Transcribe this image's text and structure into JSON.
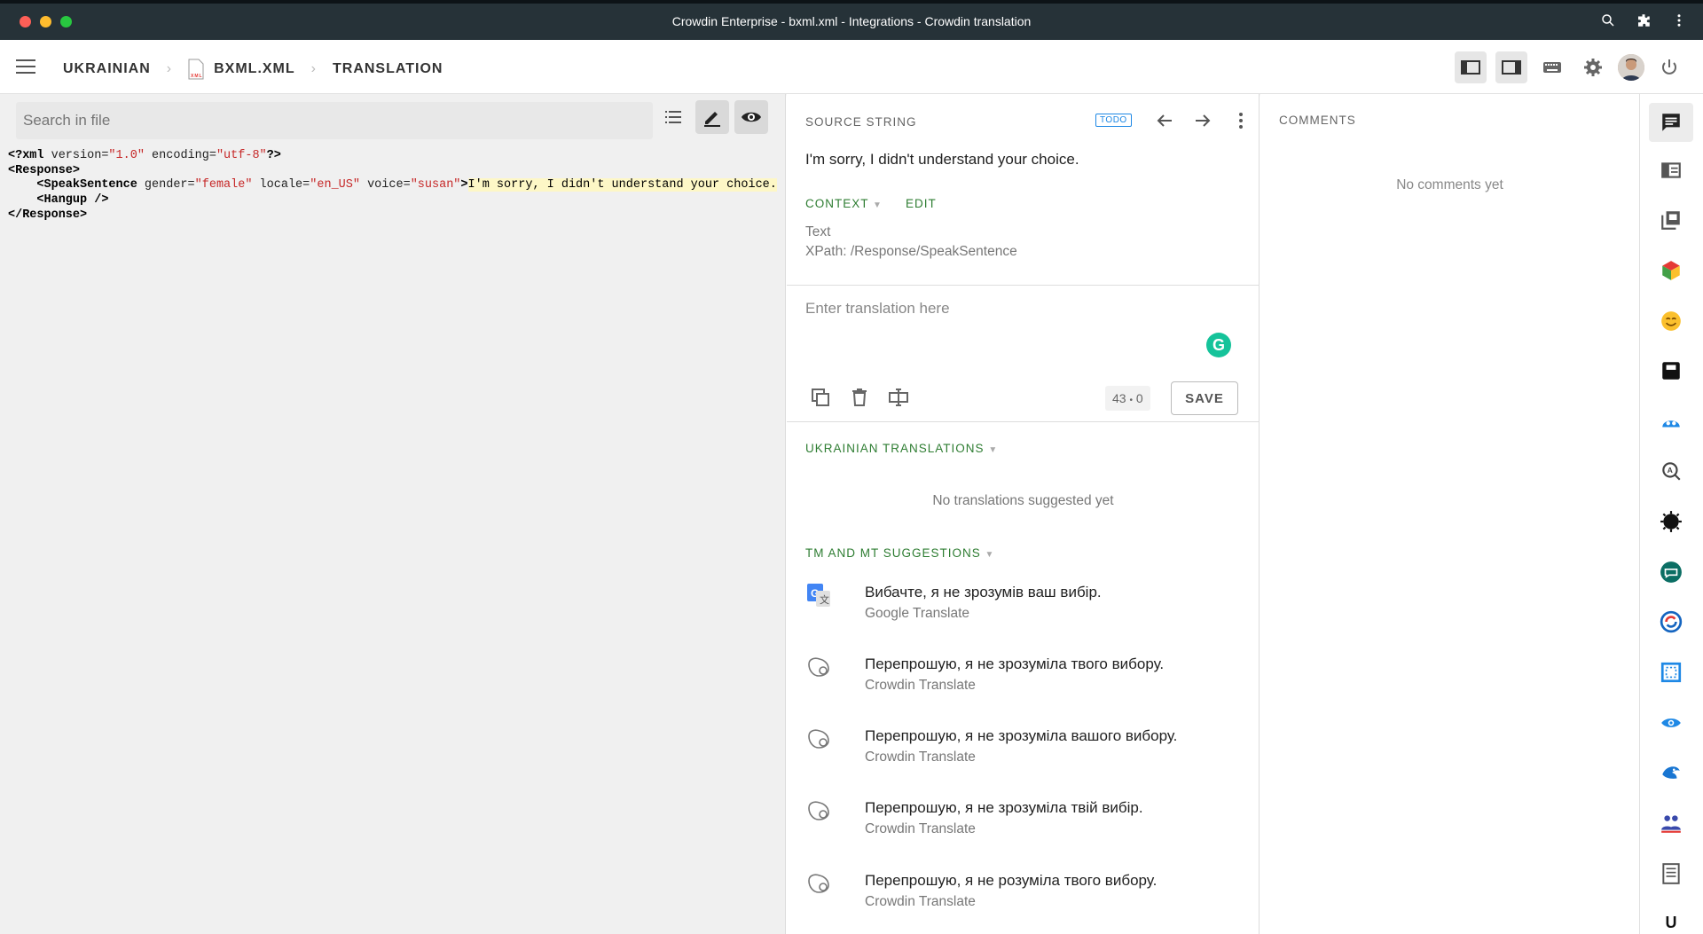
{
  "window": {
    "title": "Crowdin Enterprise - bxml.xml - Integrations - Crowdin translation"
  },
  "breadcrumb": {
    "language": "UKRAINIAN",
    "file": "BXML.XML",
    "file_badge": "XML",
    "mode": "TRANSLATION"
  },
  "editor": {
    "search_placeholder": "Search in file",
    "code": {
      "l1_open": "<?xml ",
      "l1_a1": "version=",
      "l1_v1": "\"1.0\"",
      "l1_a2": " encoding=",
      "l1_v2": "\"utf-8\"",
      "l1_close": "?>",
      "l2": "<Response>",
      "l3_open": "<SpeakSentence",
      "l3_a1": " gender=",
      "l3_v1": "\"female\"",
      "l3_a2": " locale=",
      "l3_v2": "\"en_US\"",
      "l3_a3": " voice=",
      "l3_v3": "\"susan\"",
      "l3_close": ">",
      "l3_text": "I'm sorry, I didn't understand your choice.",
      "l4": "<Hangup />",
      "l5": "</Response>"
    }
  },
  "source": {
    "label": "SOURCE STRING",
    "status": "TODO",
    "text": "I'm sorry, I didn't understand your choice.",
    "context_label": "CONTEXT",
    "edit_label": "EDIT",
    "context_type": "Text",
    "context_xpath": "XPath: /Response/SpeakSentence"
  },
  "translation": {
    "placeholder": "Enter translation here",
    "grammarly": "G",
    "count_source": "43",
    "count_sep": "•",
    "count_target": "0",
    "save_label": "SAVE"
  },
  "ukrainian_translations": {
    "label": "UKRAINIAN TRANSLATIONS",
    "empty": "No translations suggested yet"
  },
  "tm_mt": {
    "label": "TM AND MT SUGGESTIONS",
    "suggestions": [
      {
        "text": "Вибачте, я не зрозумів ваш вибір.",
        "source": "Google Translate"
      },
      {
        "text": "Перепрошую, я не зрозуміла твого вибору.",
        "source": "Crowdin Translate"
      },
      {
        "text": "Перепрошую, я не зрозуміла вашого вибору.",
        "source": "Crowdin Translate"
      },
      {
        "text": "Перепрошую, я не зрозуміла твій вибір.",
        "source": "Crowdin Translate"
      },
      {
        "text": "Перепрошую, я не розуміла твого вибору.",
        "source": "Crowdin Translate"
      }
    ]
  },
  "comments": {
    "label": "COMMENTS",
    "empty": "No comments yet"
  },
  "sidebar": {
    "last_item_letter": "U"
  },
  "colors": {
    "accent_green": "#2e7d32",
    "todo_blue": "#1e88e5",
    "titlebar": "#263238",
    "code_highlight": "#fdf7c6"
  }
}
